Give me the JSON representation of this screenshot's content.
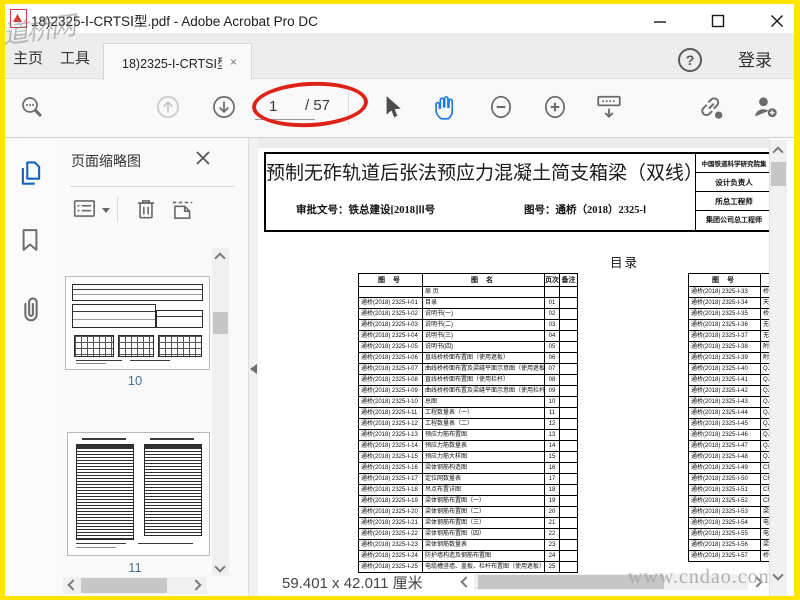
{
  "window": {
    "title": "18)2325-Ⅰ-CRTSⅠ型.pdf - Adobe Acrobat Pro DC",
    "watermark_logo": "道桥网"
  },
  "tabs": {
    "home": "主页",
    "tools": "工具",
    "document": "18)2325-I-CRTSI型.p...",
    "close_glyph": "×",
    "help_glyph": "?",
    "sign_in": "登录"
  },
  "toolbar": {
    "page_current": "1",
    "page_total": "/ 57"
  },
  "panel": {
    "title": "页面缩略图",
    "thumb_labels": [
      "10",
      "11"
    ]
  },
  "doc": {
    "main_title": "预制无砟轨道后张法预应力混凝土简支箱梁（双线）",
    "approval": "审批文号：铁总建设[2018]ⅠⅠ号",
    "drawing_no": "图号：通桥（2018）2325-Ⅰ",
    "org": "中国铁道科学研究院集",
    "roles": [
      "设计负责人",
      "所总工程师",
      "集团公司总工程师"
    ],
    "toc_title": "目录",
    "toc_left": {
      "headers": [
        "图 号",
        "图 名",
        "页次",
        "备注"
      ],
      "rows": [
        [
          "",
          "扉 页",
          "",
          ""
        ],
        [
          "通桥(2018) 2325-Ⅰ-01",
          "目录",
          "01",
          ""
        ],
        [
          "通桥(2018) 2325-Ⅰ-02",
          "说明书(一)",
          "02",
          ""
        ],
        [
          "通桥(2018) 2325-Ⅰ-03",
          "说明书(二)",
          "03",
          ""
        ],
        [
          "通桥(2018) 2325-Ⅰ-04",
          "说明书(三)",
          "04",
          ""
        ],
        [
          "通桥(2018) 2325-Ⅰ-05",
          "说明书(四)",
          "05",
          ""
        ],
        [
          "通桥(2018) 2325-Ⅰ-06",
          "直线桥桥面布置图（使用遮板）",
          "06",
          ""
        ],
        [
          "通桥(2018) 2325-Ⅰ-07",
          "曲线桥桥面布置及梁缝平面示意图（使用遮板）",
          "07",
          ""
        ],
        [
          "通桥(2018) 2325-Ⅰ-08",
          "直线桥桥面布置图（使用栏杆）",
          "08",
          ""
        ],
        [
          "通桥(2018) 2325-Ⅰ-09",
          "曲线桥桥面布置及梁缝平面示意图（使用栏杆）",
          "09",
          ""
        ],
        [
          "通桥(2018) 2325-Ⅰ-10",
          "总图",
          "10",
          ""
        ],
        [
          "通桥(2018) 2325-Ⅰ-11",
          "工程数量表（一）",
          "11",
          ""
        ],
        [
          "通桥(2018) 2325-Ⅰ-12",
          "工程数量表（二）",
          "12",
          ""
        ],
        [
          "通桥(2018) 2325-Ⅰ-13",
          "预应力筋布置图",
          "13",
          ""
        ],
        [
          "通桥(2018) 2325-Ⅰ-14",
          "预应力筋数量表",
          "14",
          ""
        ],
        [
          "通桥(2018) 2325-Ⅰ-15",
          "预应力筋大样图",
          "15",
          ""
        ],
        [
          "通桥(2018) 2325-Ⅰ-16",
          "梁体钢筋构造图",
          "16",
          ""
        ],
        [
          "通桥(2018) 2325-Ⅰ-17",
          "定位网数量表",
          "17",
          ""
        ],
        [
          "通桥(2018) 2325-Ⅰ-18",
          "吊点布置详图",
          "18",
          ""
        ],
        [
          "通桥(2018) 2325-Ⅰ-19",
          "梁体钢筋布置图（一）",
          "19",
          ""
        ],
        [
          "通桥(2018) 2325-Ⅰ-20",
          "梁体钢筋布置图（二）",
          "20",
          ""
        ],
        [
          "通桥(2018) 2325-Ⅰ-21",
          "梁体钢筋布置图（三）",
          "21",
          ""
        ],
        [
          "通桥(2018) 2325-Ⅰ-22",
          "梁体钢筋布置图（四）",
          "22",
          ""
        ],
        [
          "通桥(2018) 2325-Ⅰ-23",
          "梁体钢筋数量表",
          "23",
          ""
        ],
        [
          "通桥(2018) 2325-Ⅰ-24",
          "防护墙构造及钢筋布置图",
          "24",
          ""
        ],
        [
          "通桥(2018) 2325-Ⅰ-25",
          "电缆槽竖墙、盖板、栏杆布置图（使用遮板）",
          "25",
          ""
        ]
      ]
    },
    "toc_right": {
      "headers": [
        "图 号",
        ""
      ],
      "rows": [
        [
          "通桥(2018) 2325-Ⅰ-33",
          "桥"
        ],
        [
          "通桥(2018) 2325-Ⅰ-34",
          "天"
        ],
        [
          "通桥(2018) 2325-Ⅰ-35",
          "桥"
        ],
        [
          "通桥(2018) 2325-Ⅰ-36",
          "无"
        ],
        [
          "通桥(2018) 2325-Ⅰ-37",
          "无"
        ],
        [
          "通桥(2018) 2325-Ⅰ-38",
          "附"
        ],
        [
          "通桥(2018) 2325-Ⅰ-39",
          "附"
        ],
        [
          "通桥(2018) 2325-Ⅰ-40",
          "QJ-"
        ],
        [
          "通桥(2018) 2325-Ⅰ-41",
          "QJ-"
        ],
        [
          "通桥(2018) 2325-Ⅰ-42",
          "QJ-"
        ],
        [
          "通桥(2018) 2325-Ⅰ-43",
          "QJ-"
        ],
        [
          "通桥(2018) 2325-Ⅰ-44",
          "QJ-"
        ],
        [
          "通桥(2018) 2325-Ⅰ-45",
          "QJ-"
        ],
        [
          "通桥(2018) 2325-Ⅰ-46",
          "QJ-"
        ],
        [
          "通桥(2018) 2325-Ⅰ-47",
          "QJ-"
        ],
        [
          "通桥(2018) 2325-Ⅰ-48",
          "QJ-"
        ],
        [
          "通桥(2018) 2325-Ⅰ-49",
          "CRT"
        ],
        [
          "通桥(2018) 2325-Ⅰ-50",
          "CRT"
        ],
        [
          "通桥(2018) 2325-Ⅰ-51",
          "CRT"
        ],
        [
          "通桥(2018) 2325-Ⅰ-52",
          "CRT"
        ],
        [
          "通桥(2018) 2325-Ⅰ-53",
          "梁"
        ],
        [
          "通桥(2018) 2325-Ⅰ-54",
          "电"
        ],
        [
          "通桥(2018) 2325-Ⅰ-55",
          "电"
        ],
        [
          "通桥(2018) 2325-Ⅰ-56",
          "梁"
        ],
        [
          "通桥(2018) 2325-Ⅰ-57",
          "桥"
        ]
      ]
    }
  },
  "statusbar": {
    "dimensions": "59.401 x 42.011 厘米"
  },
  "site_watermark": "www.cndao.com"
}
